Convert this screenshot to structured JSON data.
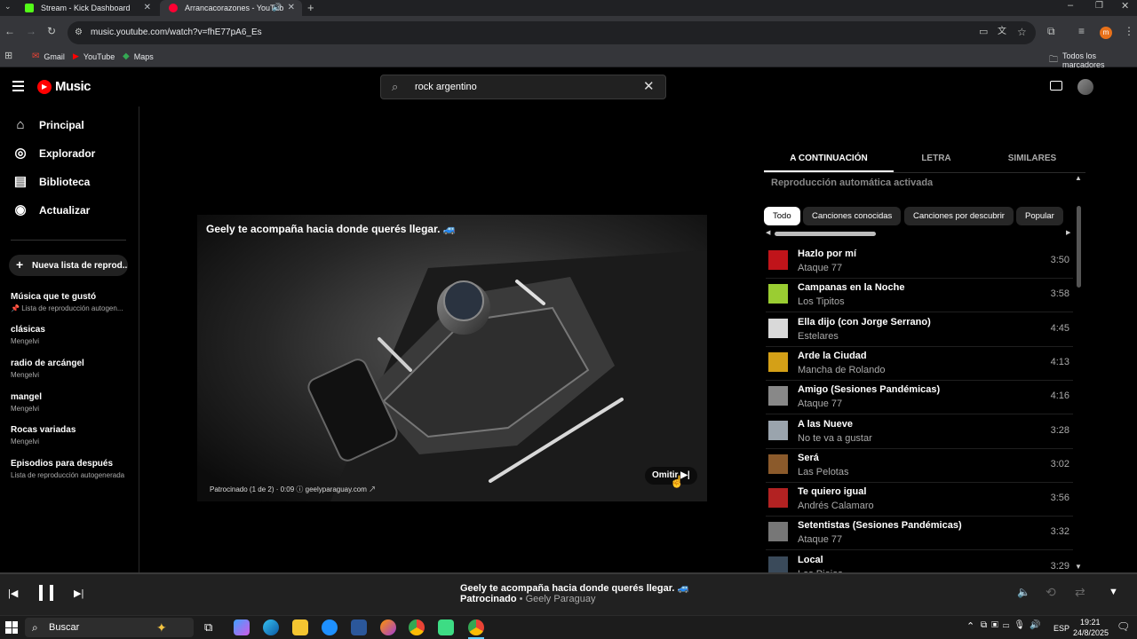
{
  "browser": {
    "tabs": [
      {
        "title": "Stream - Kick Dashboard",
        "favicon_color": "#53fc18"
      },
      {
        "title": "Arrancacorazones - YouTub",
        "favicon_color": "#ff0033"
      }
    ],
    "url": "music.youtube.com/watch?v=fhE77pA6_Es",
    "bookmarks": [
      "Gmail",
      "YouTube",
      "Maps"
    ],
    "all_bookmarks": "Todos los marcadores"
  },
  "ytm": {
    "logo": "Music",
    "search_value": "rock argentino",
    "nav": [
      {
        "label": "Principal",
        "icon": "home-icon"
      },
      {
        "label": "Explorador",
        "icon": "compass-icon"
      },
      {
        "label": "Biblioteca",
        "icon": "library-icon"
      },
      {
        "label": "Actualizar",
        "icon": "upgrade-icon"
      }
    ],
    "new_playlist": "Nueva lista de reprod...",
    "playlists": [
      {
        "title": "Música que te gustó",
        "sub": "Lista de reproducción autogen..."
      },
      {
        "title": "clásicas",
        "sub": "Mengelvi"
      },
      {
        "title": "radio de arcángel",
        "sub": "Mengelvi"
      },
      {
        "title": "mangel",
        "sub": "Mengelvi"
      },
      {
        "title": "Rocas variadas",
        "sub": "Mengelvi"
      },
      {
        "title": "Episodios para después",
        "sub": "Lista de reproducción autogenerada"
      }
    ],
    "ad": {
      "headline": "Geely te acompaña hacia donde querés llegar. 🚙",
      "sponsored": "Patrocinado (1 de 2) · 0:09",
      "domain": "geelyparaguay.com",
      "skip": "Omitir"
    },
    "panel_tabs": [
      "A CONTINUACIÓN",
      "LETRA",
      "SIMILARES"
    ],
    "autoplay": "Reproducción automática activada",
    "chips": [
      "Todo",
      "Canciones conocidas",
      "Canciones por descubrir",
      "Popular"
    ],
    "queue": [
      {
        "title": "Hazlo por mí",
        "artist": "Ataque 77",
        "duration": "3:50",
        "color": "#c0141a"
      },
      {
        "title": "Campanas en la Noche",
        "artist": "Los Tipitos",
        "duration": "3:58",
        "color": "#9acd32"
      },
      {
        "title": "Ella dijo (con Jorge Serrano)",
        "artist": "Estelares",
        "duration": "4:45",
        "color": "#d9d9d9"
      },
      {
        "title": "Arde la Ciudad",
        "artist": "Mancha de Rolando",
        "duration": "4:13",
        "color": "#d4a017"
      },
      {
        "title": "Amigo (Sesiones Pandémicas)",
        "artist": "Ataque 77",
        "duration": "4:16",
        "color": "#888888"
      },
      {
        "title": "A las Nueve",
        "artist": "No te va a gustar",
        "duration": "3:28",
        "color": "#9aa4ad"
      },
      {
        "title": "Será",
        "artist": "Las Pelotas",
        "duration": "3:02",
        "color": "#8b5a2b"
      },
      {
        "title": "Te quiero igual",
        "artist": "Andrés Calamaro",
        "duration": "3:56",
        "color": "#b22222"
      },
      {
        "title": "Setentistas (Sesiones Pandémicas)",
        "artist": "Ataque 77",
        "duration": "3:32",
        "color": "#777777"
      },
      {
        "title": "Local",
        "artist": "Los Piojos",
        "duration": "3:29",
        "color": "#3a4a5a"
      }
    ],
    "player": {
      "title": "Geely te acompaña hacia donde querés llegar. 🚙",
      "tag": "Patrocinado",
      "sep": "•",
      "advertiser": "Geely Paraguay"
    }
  },
  "taskbar": {
    "search": "Buscar",
    "lang": "ESP",
    "time": "19:21",
    "date": "24/8/2025"
  }
}
